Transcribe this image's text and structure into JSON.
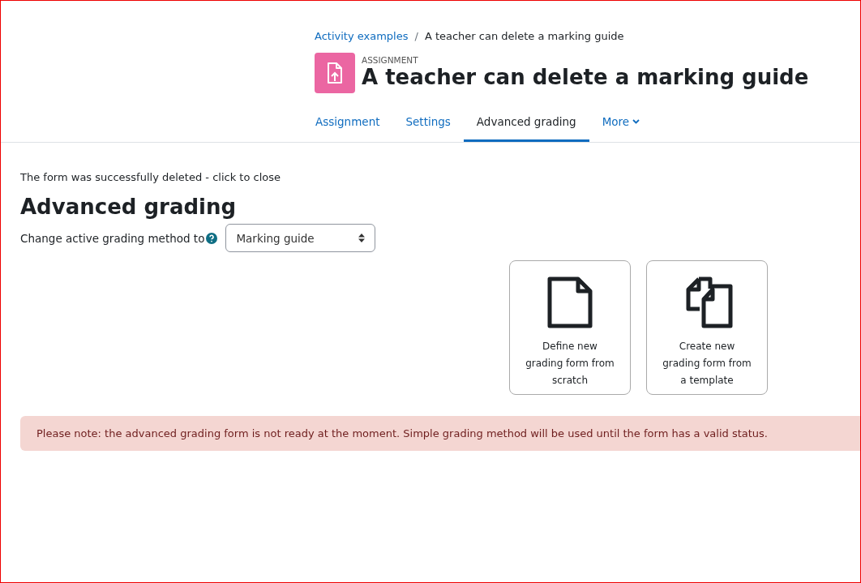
{
  "breadcrumb": [
    {
      "label": "Activity examples",
      "kind": "link"
    },
    {
      "label": "A teacher can delete a marking guide",
      "kind": "current"
    }
  ],
  "breadcrumb_separator": "/",
  "header": {
    "module_type": "ASSIGNMENT",
    "title": "A teacher can delete a marking guide"
  },
  "tabs": [
    {
      "label": "Assignment",
      "selected": false,
      "kind": "link"
    },
    {
      "label": "Settings",
      "selected": false,
      "kind": "link"
    },
    {
      "label": "Advanced grading",
      "selected": true,
      "kind": "link"
    },
    {
      "label": "More",
      "selected": false,
      "kind": "dropdown"
    }
  ],
  "notification": "The form was successfully deleted - click to close",
  "heading": "Advanced grading",
  "method": {
    "label": "Change active grading method to",
    "value": "Marking guide"
  },
  "options": [
    {
      "kind": "blank",
      "label": "Define new grading form from scratch"
    },
    {
      "kind": "template",
      "label": "Create new grading form from a template"
    }
  ],
  "alert": "Please note: the advanced grading form is not ready at the moment. Simple grading method will be used until the form has a valid status."
}
